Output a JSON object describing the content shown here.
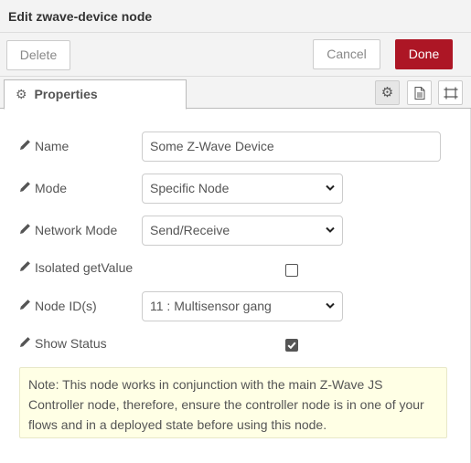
{
  "header": {
    "title": "Edit zwave-device node"
  },
  "toolbar": {
    "delete_label": "Delete",
    "cancel_label": "Cancel",
    "done_label": "Done",
    "done_color": "#ad1625"
  },
  "tabs": {
    "properties_label": "Properties"
  },
  "form": {
    "name": {
      "label": "Name",
      "value": "Some Z-Wave Device"
    },
    "mode": {
      "label": "Mode",
      "value": "Specific Node"
    },
    "network_mode": {
      "label": "Network Mode",
      "value": "Send/Receive"
    },
    "isolated_getvalue": {
      "label": "Isolated getValue",
      "checked": false
    },
    "node_ids": {
      "label": "Node ID(s)",
      "value": "11 : Multisensor gang"
    },
    "show_status": {
      "label": "Show Status",
      "checked": true
    }
  },
  "note": "Note: This node works in conjunction with the main Z-Wave JS Controller node, therefore, ensure the controller node is in one of your flows and in a deployed state before using this node."
}
